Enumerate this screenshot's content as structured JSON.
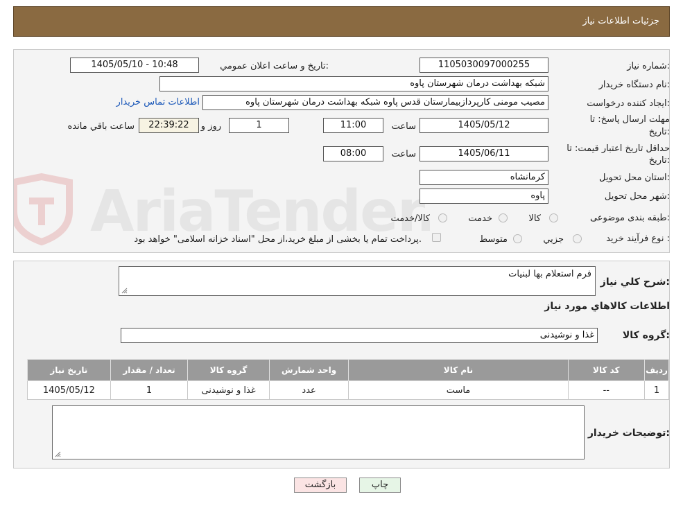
{
  "header": {
    "title": "جزئيات اطلاعات نياز"
  },
  "form": {
    "need_number_label": "شماره نياز:",
    "need_number": "1105030097000255",
    "announce_label": "تاريخ و ساعت اعلان عمومي:",
    "announce_value": "1405/05/10 - 10:48",
    "buyer_label": "نام دستگاه خريدار:",
    "buyer_value": "شبکه بهداشت درمان شهرستان پاوه",
    "creator_label": "ايجاد کننده درخواست:",
    "creator_value": "مصیب مومنی کارپردازبیمارستان قدس پاوه شبکه بهداشت درمان شهرستان پاوه",
    "contact_link": "اطلاعات تماس خريدار",
    "deadline_label_1": "مهلت ارسال پاسخ: تا",
    "deadline_label_2": "تاريخ:",
    "deadline_date": "1405/05/12",
    "time_label": "ساعت",
    "deadline_time": "11:00",
    "days_value": "1",
    "days_label": "روز و",
    "remaining_value": "22:39:22",
    "remaining_label": "ساعت باقي مانده",
    "validity_label_1": "حداقل تاريخ اعتبار قيمت: تا",
    "validity_label_2": "تاريخ:",
    "validity_date": "1405/06/11",
    "validity_time": "08:00",
    "province_label": "استان محل تحويل:",
    "province_value": "کرمانشاه",
    "city_label": "شهر محل تحويل:",
    "city_value": "پاوه",
    "category_label": "طبقه بندی موضوعی:",
    "category_options": [
      "کالا",
      "خدمت",
      "کالا/خدمت"
    ],
    "process_label": "نوع فرآيند خريد :",
    "process_options": [
      "جزيي",
      "متوسط"
    ],
    "payment_note": "پرداخت تمام يا بخشی از مبلغ خريد،از محل \"اسناد خزانه اسلامی\" خواهد بود."
  },
  "details": {
    "summary_label": "شرح کلي نياز:",
    "summary_value": "فرم استعلام بها لبنیات",
    "items_title": "اطلاعات کالاهاي مورد نياز",
    "group_label": "گروه کالا:",
    "group_value": "غذا و نوشیدنی",
    "table": {
      "headers": [
        "رديف",
        "کد کالا",
        "نام کالا",
        "واحد شمارش",
        "گروه کالا",
        "تعداد / مقدار",
        "تاريخ نياز"
      ],
      "rows": [
        [
          "1",
          "--",
          "ماست",
          "عدد",
          "غذا و نوشیدنی",
          "1",
          "1405/05/12"
        ]
      ]
    },
    "buyer_notes_label": "توضيحات خريدار:"
  },
  "buttons": {
    "print": "چاپ",
    "back": "بازگشت"
  },
  "watermark": {
    "text": "AriaTender.neT"
  },
  "colors": {
    "header_bg": "#8a6a41",
    "link": "#1a57b8",
    "back_btn": "#fbe4e4",
    "print_btn": "#e6f5e6"
  }
}
